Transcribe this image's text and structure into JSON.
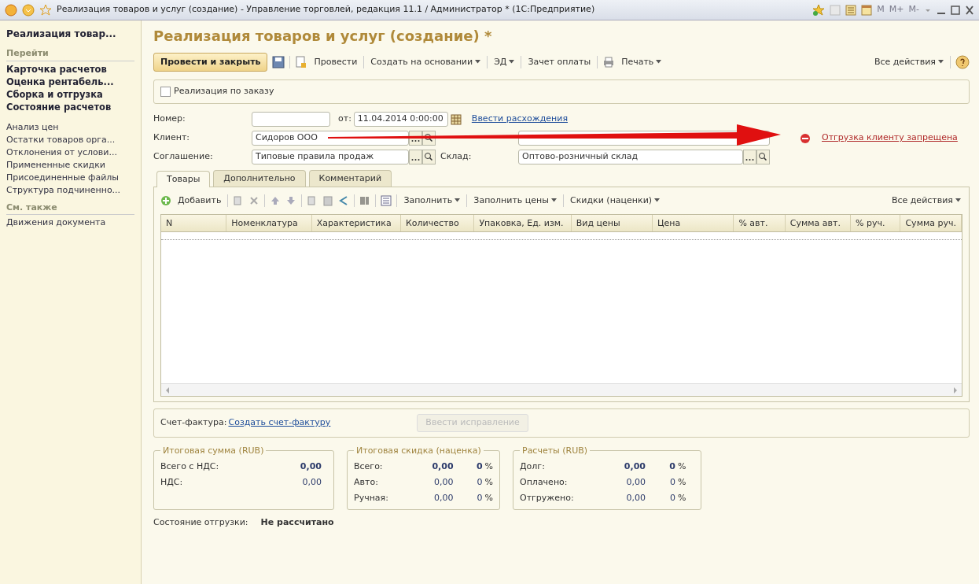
{
  "window": {
    "title": "Реализация товаров и услуг (создание) - Управление торговлей, редакция 11.1 / Администратор * (1С:Предприятие)",
    "memory_keys": [
      "M",
      "M+",
      "M-"
    ]
  },
  "sidebar": {
    "title": "Реализация товар...",
    "groups": [
      {
        "heading": "Перейти",
        "kind": "bold",
        "items": [
          "Карточка расчетов",
          "Оценка рентабель...",
          "Сборка и отгрузка",
          "Состояние расчетов"
        ]
      },
      {
        "kind": "plain",
        "items": [
          "Анализ цен",
          "Остатки товаров орга...",
          "Отклонения от услови...",
          "Примененные скидки",
          "Присоединенные файлы",
          "Структура подчиненно..."
        ]
      },
      {
        "heading": "См. также",
        "kind": "plain",
        "items": [
          "Движения документа"
        ]
      }
    ]
  },
  "form": {
    "title": "Реализация товаров и услуг (создание) *",
    "toolbar": [
      {
        "kind": "primary",
        "label": "Провести и закрыть"
      },
      {
        "kind": "save"
      },
      {
        "kind": "post",
        "label": "Провести"
      },
      {
        "kind": "dropdown",
        "label": "Создать на основании"
      },
      {
        "kind": "dropdown",
        "label": "ЭД"
      },
      {
        "kind": "plain",
        "label": "Зачет оплаты"
      },
      {
        "kind": "print",
        "label": "Печать"
      }
    ],
    "all_actions": "Все действия",
    "by_order": {
      "label": "Реализация по заказу",
      "checked": false
    },
    "number": {
      "label": "Номер:",
      "date_label": "от:",
      "date": "11.04.2014  0:00:00",
      "link": "Ввести расхождения"
    },
    "client": {
      "label": "Клиент:",
      "value": "Сидоров ООО"
    },
    "warning": "Отгрузка клиенту запрещена",
    "agreement": {
      "label": "Соглашение:",
      "value": "Типовые правила продаж"
    },
    "warehouse": {
      "label": "Склад:",
      "value": "Оптово-розничный склад"
    },
    "tabs": [
      {
        "label": "Товары",
        "selected": true
      },
      {
        "label": "Дополнительно",
        "selected": false
      },
      {
        "label": "Комментарий",
        "selected": false
      }
    ],
    "table_toolbar": {
      "add": "Добавить",
      "menus": [
        "Заполнить",
        "Заполнить цены",
        "Скидки (наценки)"
      ],
      "all_actions": "Все действия"
    },
    "table": {
      "columns": [
        "N",
        "Номенклатура",
        "Характеристика",
        "Количество",
        "Упаковка, Ед. изм.",
        "Вид цены",
        "Цена",
        "% авт.",
        "Сумма авт.",
        "% руч.",
        "Сумма руч."
      ]
    },
    "invoice": {
      "label": "Счет-фактура:",
      "link": "Создать счет-фактуру",
      "button": "Ввести исправление",
      "disabled": true
    },
    "totals": [
      {
        "title": "Итоговая сумма (RUB)",
        "rows": [
          {
            "label": "Всего с НДС:",
            "value": "0,00",
            "bold": true
          },
          {
            "label": "НДС:",
            "value": "0,00",
            "bold": false
          }
        ]
      },
      {
        "title": "Итоговая скидка (наценка)",
        "rows": [
          {
            "label": "Всего:",
            "value": "0,00",
            "percent": "0",
            "bold": true
          },
          {
            "label": "Авто:",
            "value": "0,00",
            "percent": "0",
            "bold": false
          },
          {
            "label": "Ручная:",
            "value": "0,00",
            "percent": "0",
            "bold": false
          }
        ]
      },
      {
        "title": "Расчеты (RUB)",
        "rows": [
          {
            "label": "Долг:",
            "value": "0,00",
            "percent": "0",
            "bold": true
          },
          {
            "label": "Оплачено:",
            "value": "0,00",
            "percent": "0",
            "bold": false
          },
          {
            "label": "Отгружено:",
            "value": "0,00",
            "percent": "0",
            "bold": false
          }
        ]
      }
    ],
    "percent_sign": "%",
    "shipment": {
      "label": "Состояние отгрузки:",
      "value": "Не рассчитано"
    }
  }
}
